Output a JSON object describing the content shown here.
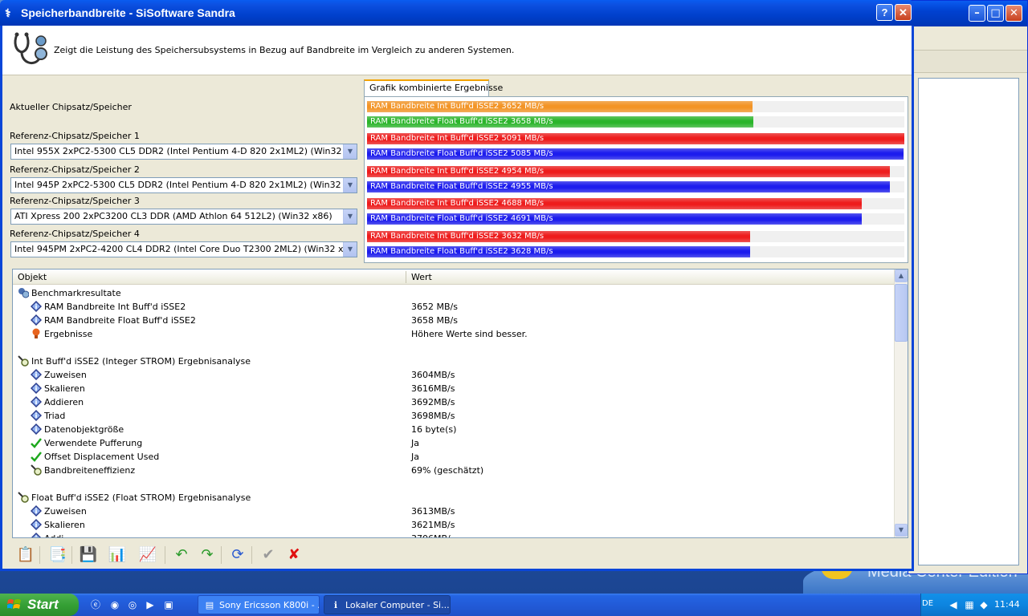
{
  "window": {
    "title": "Speicherbandbreite - SiSoftware Sandra",
    "help_label": "?",
    "close_label": "✕"
  },
  "header": {
    "description": "Zeigt die Leistung des Speichersubsystems in Bezug auf Bandbreite im Vergleich zu anderen Systemen."
  },
  "selectors": {
    "current_label": "Aktueller Chipsatz/Speicher",
    "refs": [
      {
        "label": "Referenz-Chipsatz/Speicher 1",
        "value": "Intel 955X 2xPC2-5300 CL5 DDR2 (Intel Pentium 4-D 820 2x1ML2) (Win32 x86)"
      },
      {
        "label": "Referenz-Chipsatz/Speicher 2",
        "value": "Intel 945P 2xPC2-5300 CL5 DDR2 (Intel Pentium 4-D 820 2x1ML2) (Win32 x86)"
      },
      {
        "label": "Referenz-Chipsatz/Speicher 3",
        "value": "ATI Xpress 200 2xPC3200 CL3 DDR (AMD Athlon 64 512L2) (Win32 x86)"
      },
      {
        "label": "Referenz-Chipsatz/Speicher 4",
        "value": "Intel 945PM 2xPC2-4200 CL4 DDR2 (Intel Core Duo T2300 2ML2) (Win32 x86)"
      }
    ]
  },
  "graph": {
    "tab_label": "Grafik kombinierte Ergebnisse",
    "max": 5091,
    "bars": [
      {
        "label": "RAM Bandbreite Int Buff'd iSSE2 3652 MB/s",
        "value": 3652,
        "color": "#f39425"
      },
      {
        "label": "RAM Bandbreite Float Buff'd iSSE2 3658 MB/s",
        "value": 3658,
        "color": "#2bb52b"
      },
      {
        "label": "RAM Bandbreite Int Buff'd iSSE2 5091 MB/s",
        "value": 5091,
        "color": "#ee1c1c"
      },
      {
        "label": "RAM Bandbreite Float Buff'd iSSE2 5085 MB/s",
        "value": 5085,
        "color": "#1c1cee"
      },
      {
        "label": "RAM Bandbreite Int Buff'd iSSE2 4954 MB/s",
        "value": 4954,
        "color": "#ee1c1c"
      },
      {
        "label": "RAM Bandbreite Float Buff'd iSSE2 4955 MB/s",
        "value": 4955,
        "color": "#1c1cee"
      },
      {
        "label": "RAM Bandbreite Int Buff'd iSSE2 4688 MB/s",
        "value": 4688,
        "color": "#ee1c1c"
      },
      {
        "label": "RAM Bandbreite Float Buff'd iSSE2 4691 MB/s",
        "value": 4691,
        "color": "#1c1cee"
      },
      {
        "label": "RAM Bandbreite Int Buff'd iSSE2 3632 MB/s",
        "value": 3632,
        "color": "#ee1c1c"
      },
      {
        "label": "RAM Bandbreite Float Buff'd iSSE2 3628 MB/s",
        "value": 3628,
        "color": "#1c1cee"
      }
    ]
  },
  "list": {
    "col_object": "Objekt",
    "col_value": "Wert",
    "rows": [
      {
        "key": "Benchmarkresultate",
        "value": "",
        "level": 0,
        "icon": "benchmark-icon"
      },
      {
        "key": "RAM Bandbreite Int Buff'd iSSE2",
        "value": "3652 MB/s",
        "level": 1,
        "icon": "info-diamond-icon"
      },
      {
        "key": "RAM Bandbreite Float Buff'd iSSE2",
        "value": "3658 MB/s",
        "level": 1,
        "icon": "info-diamond-icon"
      },
      {
        "key": "Ergebnisse",
        "value": "Höhere Werte sind besser.",
        "level": 1,
        "icon": "hint-bulb-icon"
      },
      {
        "key": "",
        "value": "",
        "level": 0,
        "icon": ""
      },
      {
        "key": "Int Buff'd iSSE2 (Integer STROM) Ergebnisanalyse",
        "value": "",
        "level": 0,
        "icon": "magnifier-icon"
      },
      {
        "key": "Zuweisen",
        "value": "3604MB/s",
        "level": 1,
        "icon": "info-diamond-icon"
      },
      {
        "key": "Skalieren",
        "value": "3616MB/s",
        "level": 1,
        "icon": "info-diamond-icon"
      },
      {
        "key": "Addieren",
        "value": "3692MB/s",
        "level": 1,
        "icon": "info-diamond-icon"
      },
      {
        "key": "Triad",
        "value": "3698MB/s",
        "level": 1,
        "icon": "info-diamond-icon"
      },
      {
        "key": "Datenobjektgröße",
        "value": "16 byte(s)",
        "level": 1,
        "icon": "info-diamond-icon"
      },
      {
        "key": "Verwendete Pufferung",
        "value": "Ja",
        "level": 1,
        "icon": "checkmark-icon"
      },
      {
        "key": "Offset Displacement Used",
        "value": "Ja",
        "level": 1,
        "icon": "checkmark-icon"
      },
      {
        "key": "Bandbreiteneffizienz",
        "value": "69% (geschätzt)",
        "level": 1,
        "icon": "magnifier-icon"
      },
      {
        "key": "",
        "value": "",
        "level": 0,
        "icon": ""
      },
      {
        "key": "Float Buff'd iSSE2 (Float STROM) Ergebnisanalyse",
        "value": "",
        "level": 0,
        "icon": "magnifier-icon"
      },
      {
        "key": "Zuweisen",
        "value": "3613MB/s",
        "level": 1,
        "icon": "info-diamond-icon"
      },
      {
        "key": "Skalieren",
        "value": "3621MB/s",
        "level": 1,
        "icon": "info-diamond-icon"
      },
      {
        "key": "Addi",
        "value": "3706MB/",
        "level": 1,
        "icon": "info-diamond-icon"
      }
    ]
  },
  "toolbar": {
    "buttons": [
      {
        "name": "report-button",
        "glyph": "📋"
      },
      {
        "name": "copy-button",
        "glyph": "📑"
      },
      {
        "name": "save-button",
        "glyph": "💾"
      },
      {
        "name": "chart-button",
        "glyph": "📊"
      },
      {
        "name": "graph-options-button",
        "glyph": "📈"
      },
      {
        "name": "back-button",
        "glyph": "↶"
      },
      {
        "name": "forward-button",
        "glyph": "↷"
      },
      {
        "name": "refresh-button",
        "glyph": "⟳"
      },
      {
        "name": "ok-button",
        "glyph": "✔"
      },
      {
        "name": "cancel-button",
        "glyph": "✘"
      }
    ]
  },
  "desktop": {
    "watermark": "Media Center Edition"
  },
  "taskbar": {
    "start_label": "Start",
    "tasks": [
      {
        "label": "Sony Ericsson K800i - ...",
        "active": false
      },
      {
        "label": "Lokaler Computer - Si...",
        "active": true
      }
    ],
    "lang": "DE",
    "clock": "11:44"
  },
  "colors": {
    "title_bar": "#0040cc",
    "accent_tab": "#f2a200",
    "taskbar": "#225bd8",
    "start": "#35a035"
  }
}
